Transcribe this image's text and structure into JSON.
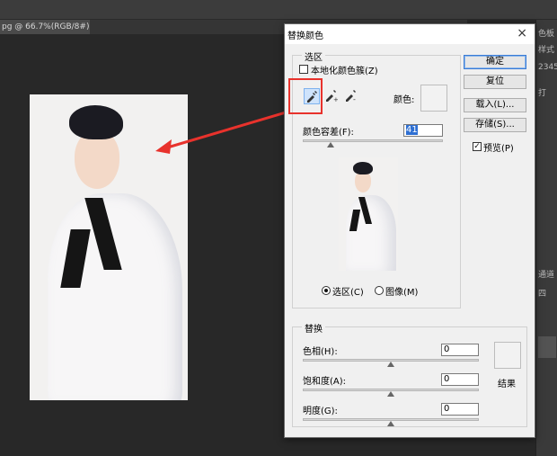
{
  "document_tab": {
    "title": "pg @ 66.7%(RGB/8#)",
    "close": "×"
  },
  "dialog": {
    "title": "替换颜色",
    "close": "×",
    "selection": {
      "group_label": "选区",
      "localized_clusters_label": "本地化颜色簇(Z)",
      "localized_clusters_checked": false,
      "color_label": "颜色:",
      "fuzziness_label": "颜色容差(F):",
      "fuzziness_value": "41",
      "fuzziness_fraction": 0.2,
      "preview_options": [
        {
          "label": "选区(C)",
          "selected": true
        },
        {
          "label": "图像(M)",
          "selected": false
        }
      ]
    },
    "buttons": {
      "ok": "确定",
      "reset": "复位",
      "load": "载入(L)...",
      "save": "存储(S)...",
      "preview_label": "预览(P)",
      "preview_checked": true
    },
    "replacement": {
      "group_label": "替换",
      "hue_label": "色相(H):",
      "hue_value": "0",
      "saturation_label": "饱和度(A):",
      "saturation_value": "0",
      "lightness_label": "明度(G):",
      "lightness_value": "0",
      "result_label": "结果"
    }
  },
  "right_panel": {
    "labels": [
      "色板",
      "样式",
      "2345",
      "打",
      "通道",
      "四"
    ]
  },
  "colors": {
    "highlight": "#e8322c",
    "accent": "#2e6fd2",
    "ps_background": "#282828"
  }
}
